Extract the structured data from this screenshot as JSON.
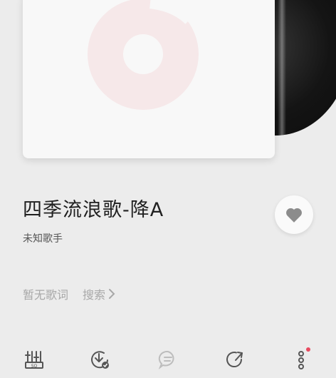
{
  "song": {
    "title": "四季流浪歌-降A",
    "artist": "未知歌手"
  },
  "lyrics": {
    "empty_text": "暂无歌词",
    "search_label": "搜索"
  },
  "icons": {
    "like": "heart-icon",
    "equalizer": "equalizer-icon",
    "download": "download-icon",
    "comment": "comment-icon",
    "share": "share-icon",
    "more": "more-icon"
  },
  "colors": {
    "background": "#ececec",
    "accent": "#e84a5f",
    "icon": "#555555",
    "muted": "#a8a8a8"
  }
}
